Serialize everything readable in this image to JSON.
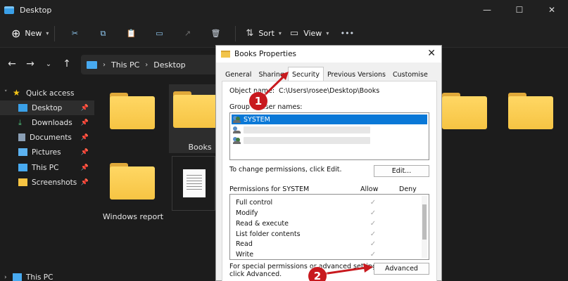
{
  "window": {
    "title": "Desktop"
  },
  "commandbar": {
    "new_label": "New",
    "sort_label": "Sort",
    "view_label": "View"
  },
  "address": {
    "crumbs": [
      "This PC",
      "Desktop"
    ]
  },
  "sidebar": {
    "items": [
      {
        "label": "Quick access",
        "icon": "star-icon"
      },
      {
        "label": "Desktop",
        "icon": "desktop-icon"
      },
      {
        "label": "Downloads",
        "icon": "download-icon"
      },
      {
        "label": "Documents",
        "icon": "documents-icon"
      },
      {
        "label": "Pictures",
        "icon": "pictures-icon"
      },
      {
        "label": "This PC",
        "icon": "pc-icon"
      },
      {
        "label": "Screenshots",
        "icon": "folder-icon"
      }
    ],
    "bottom_item": "This PC"
  },
  "files": {
    "books": "Books",
    "windows_report": "Windows report"
  },
  "dialog": {
    "title": "Books Properties",
    "tabs": [
      "General",
      "Sharing",
      "Security",
      "Previous Versions",
      "Customise"
    ],
    "active_tab": "Security",
    "object_name_label": "Object name:",
    "object_name_value": "C:\\Users\\rosee\\Desktop\\Books",
    "group_label": "Group or user names:",
    "users": [
      "SYSTEM"
    ],
    "change_text": "To change permissions, click Edit.",
    "edit_button": "Edit...",
    "permissions_label": "Permissions for SYSTEM",
    "allow_header": "Allow",
    "deny_header": "Deny",
    "permissions": [
      "Full control",
      "Modify",
      "Read & execute",
      "List folder contents",
      "Read",
      "Write"
    ],
    "special_text_1": "For special permissions or advanced settings,",
    "special_text_2": "click Advanced.",
    "advanced_button": "Advanced"
  },
  "annotations": {
    "step1": "1",
    "step2": "2",
    "color": "#c8191e"
  }
}
